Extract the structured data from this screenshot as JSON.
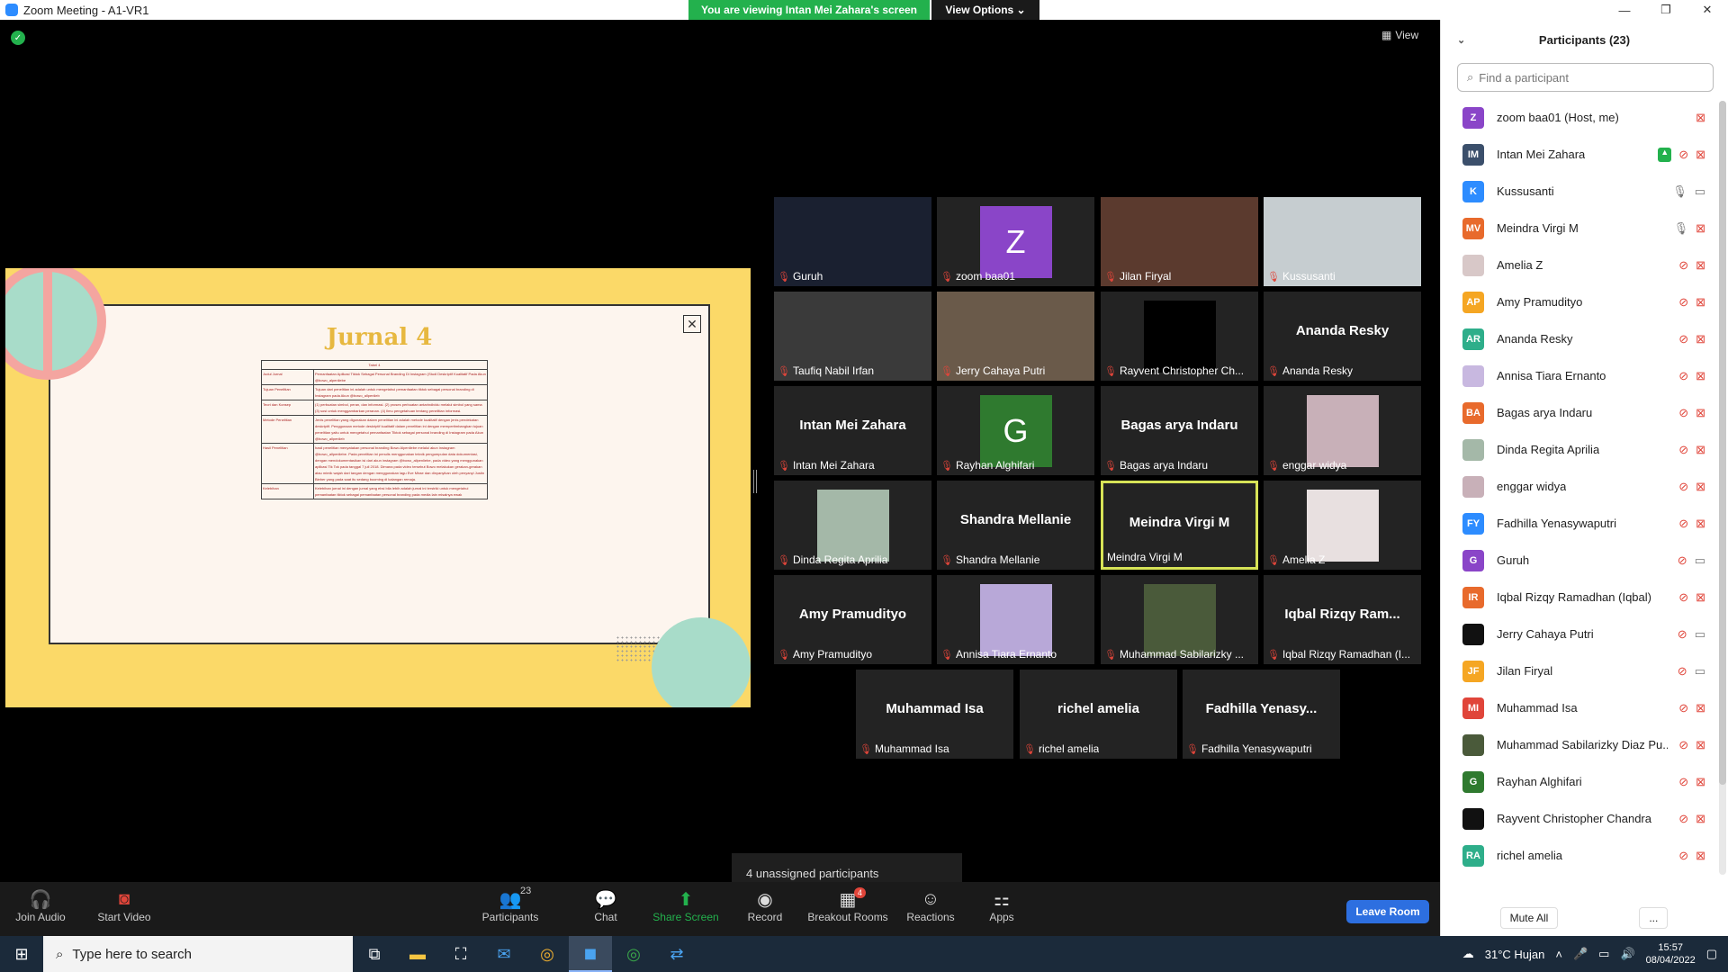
{
  "window": {
    "title": "Zoom Meeting - A1-VR1",
    "banner": "You are viewing Intan Mei Zahara's screen",
    "view_options": "View Options ⌄",
    "view_label": "View"
  },
  "slide": {
    "title": "Jurnal 4",
    "table_caption": "Tabel 4",
    "rows": [
      {
        "k": "Judul Jurnal",
        "v": "Pemanfaatan Aplikasi Tiktok Sebagai Personal Branding Di Instagram (Studi Deskriptif Kualitatif Pada Akun @bowo_alpenliebe"
      },
      {
        "k": "Tujuan Penelitian",
        "v": "Tujuan dari penelitian ini adalah untuk mengetahui pemanfaatan tiktok sebagai personal branding di Instagram pada Akun @bowo_allpenlieb"
      },
      {
        "k": "Teori dan Konsep",
        "v": "(1) perbuatan simbol, peran, dan informasi. (2) proses perbuatan antarindividu melalui simbol yang sama (3) sosi untuk menggambarkan peranan. (4) Ilmu pengetahuan tentang penelitian informasi."
      },
      {
        "k": "Metode Penelitian",
        "v": "Jenis penelitian yang digunakan dalam penelitian ini adalah metode kualitatif dengan jenis pendekatan deskriptif. Penggunaan metode deskriptif kualitatif dalam penelitian ini dengan mempertimbangkan tujuan penelitian yaitu untuk mengetahui pemanfaatan Tiktok sebagai personal branding di Instagram pada Akun @bowo_allpenlieb"
      },
      {
        "k": "Hasil Penelitian",
        "v": "hasil penelitian menyatakan personal branding Bowo Alpenliebe melalui akun instagram @bowo_allpenliebe. Pada penelitian ini penulis menggunakan teknik pengumpulan data dokumentasi, dengan mendokumentasikan isi dari akun instagram @bowo_allpenliebe, pada video yang menggunakan aplikasi Tik Tok pada tanggal 7 juli 2018. Dimana pada video tersebut Bowo melakukan gerakan-gerakan atau mimik wajah dari tangan dengan menggunakan lagu Eve Mirae dan dinyanyikan oleh penyanyi Justin Bieber yang pada saat itu sedang booming di kalangan remaja."
      },
      {
        "k": "Kelebihan",
        "v": "Kelebihan jurnal ini dengan jurnal yang ebsi bila lebih adalah jurnal ini terstriki untuk mengetahui pemanfaatan tiktok sebagai pemanfaatan personal branding pada media lain misalnya ewak"
      }
    ]
  },
  "gallery": [
    {
      "label": "Guruh",
      "big": "",
      "avatar": "photo",
      "color": "#1a2030"
    },
    {
      "label": "zoom baa01",
      "big": "",
      "avatar": "Z",
      "color": "#8a45c8"
    },
    {
      "label": "Jilan Firyal",
      "big": "",
      "avatar": "photo",
      "color": "#5b3a2e"
    },
    {
      "label": "Kussusanti",
      "big": "",
      "avatar": "photo",
      "color": "#c6cdd0"
    },
    {
      "label": "Taufiq Nabil Irfan",
      "big": "",
      "avatar": "photo",
      "color": "#3a3a3a"
    },
    {
      "label": "Jerry Cahaya Putri",
      "big": "",
      "avatar": "photo",
      "color": "#6a5a4a"
    },
    {
      "label": "Rayvent Christopher Ch...",
      "big": "",
      "avatar": "black",
      "color": "#000000"
    },
    {
      "label": "Ananda Resky",
      "big": "Ananda Resky",
      "avatar": "",
      "color": ""
    },
    {
      "label": "Intan Mei Zahara",
      "big": "Intan Mei Zahara",
      "avatar": "",
      "color": ""
    },
    {
      "label": "Rayhan Alghifari",
      "big": "",
      "avatar": "G",
      "color": "#2f7a2f"
    },
    {
      "label": "Bagas arya Indaru",
      "big": "Bagas arya Indaru",
      "avatar": "",
      "color": ""
    },
    {
      "label": "enggar widya",
      "big": "",
      "avatar": "photo",
      "color": "#c8b0b8"
    },
    {
      "label": "Dinda Regita Aprilia",
      "big": "",
      "avatar": "photo",
      "color": "#a4b8a8"
    },
    {
      "label": "Shandra Mellanie",
      "big": "Shandra Mellanie",
      "avatar": "",
      "color": ""
    },
    {
      "label": "Meindra Virgi M",
      "big": "Meindra Virgi M",
      "avatar": "",
      "color": ""
    },
    {
      "label": "Amelia Z",
      "big": "",
      "avatar": "photo",
      "color": "#e8e0e0"
    },
    {
      "label": "Amy Pramudityo",
      "big": "Amy Pramudityo",
      "avatar": "",
      "color": ""
    },
    {
      "label": "Annisa Tiara Ernanto",
      "big": "",
      "avatar": "photo",
      "color": "#b8a8d8"
    },
    {
      "label": "Muhammad Sabilarizky ...",
      "big": "",
      "avatar": "photo",
      "color": "#4a5a3a"
    },
    {
      "label": "Iqbal Rizqy Ramadhan (I...",
      "big": "Iqbal  Rizqy  Ram...",
      "avatar": "",
      "color": ""
    },
    {
      "label": "Muhammad Isa",
      "big": "Muhammad Isa",
      "avatar": "",
      "color": ""
    },
    {
      "label": "richel amelia",
      "big": "richel amelia",
      "avatar": "",
      "color": ""
    },
    {
      "label": "Fadhilla Yenasywaputri",
      "big": "Fadhilla  Yenasy...",
      "avatar": "",
      "color": ""
    }
  ],
  "unassigned": "4 unassigned participants",
  "toolbar": {
    "join_audio": "Join Audio",
    "start_video": "Start Video",
    "participants": "Participants",
    "participants_count": "23",
    "chat": "Chat",
    "share_screen": "Share Screen",
    "record": "Record",
    "breakout_rooms": "Breakout Rooms",
    "breakout_badge": "4",
    "reactions": "Reactions",
    "apps": "Apps",
    "leave": "Leave Room"
  },
  "panel": {
    "title": "Participants (23)",
    "search_placeholder": "Find a participant",
    "mute_all": "Mute All",
    "more": "...",
    "participants": [
      {
        "initials": "Z",
        "name": "zoom baa01 (Host, me)",
        "color": "#8a45c8",
        "mic": "none",
        "cam": "off",
        "share": false
      },
      {
        "initials": "IM",
        "name": "Intan Mei Zahara",
        "color": "#3b4f6b",
        "mic": "off",
        "cam": "off",
        "share": true
      },
      {
        "initials": "K",
        "name": "Kussusanti",
        "color": "#2d8cff",
        "mic": "on",
        "cam": "on",
        "share": false
      },
      {
        "initials": "MV",
        "name": "Meindra Virgi M",
        "color": "#e86a2c",
        "mic": "on",
        "cam": "off",
        "share": false
      },
      {
        "initials": "",
        "name": "Amelia Z",
        "color": "#d8c8c8",
        "mic": "off",
        "cam": "off",
        "share": false
      },
      {
        "initials": "AP",
        "name": "Amy Pramudityo",
        "color": "#f5a623",
        "mic": "off",
        "cam": "off",
        "share": false
      },
      {
        "initials": "AR",
        "name": "Ananda Resky",
        "color": "#2eae8a",
        "mic": "off",
        "cam": "off",
        "share": false
      },
      {
        "initials": "",
        "name": "Annisa Tiara Ernanto",
        "color": "#c8b8e0",
        "mic": "off",
        "cam": "off",
        "share": false
      },
      {
        "initials": "BA",
        "name": "Bagas arya Indaru",
        "color": "#e86a2c",
        "mic": "off",
        "cam": "off",
        "share": false
      },
      {
        "initials": "",
        "name": "Dinda Regita Aprilia",
        "color": "#a4b8a8",
        "mic": "off",
        "cam": "off",
        "share": false
      },
      {
        "initials": "",
        "name": "enggar widya",
        "color": "#c8b0b8",
        "mic": "off",
        "cam": "off",
        "share": false
      },
      {
        "initials": "FY",
        "name": "Fadhilla Yenasywaputri",
        "color": "#2d8cff",
        "mic": "off",
        "cam": "off",
        "share": false
      },
      {
        "initials": "G",
        "name": "Guruh",
        "color": "#8a45c8",
        "mic": "off",
        "cam": "on",
        "share": false
      },
      {
        "initials": "IR",
        "name": "Iqbal Rizqy Ramadhan (Iqbal)",
        "color": "#e86a2c",
        "mic": "off",
        "cam": "off",
        "share": false
      },
      {
        "initials": "",
        "name": "Jerry Cahaya Putri",
        "color": "#111111",
        "mic": "off",
        "cam": "on",
        "share": false
      },
      {
        "initials": "JF",
        "name": "Jilan Firyal",
        "color": "#f5a623",
        "mic": "off",
        "cam": "on",
        "share": false
      },
      {
        "initials": "MI",
        "name": "Muhammad Isa",
        "color": "#e0453a",
        "mic": "off",
        "cam": "off",
        "share": false
      },
      {
        "initials": "",
        "name": "Muhammad Sabilarizky Diaz Pu...",
        "color": "#4a5a3a",
        "mic": "off",
        "cam": "off",
        "share": false
      },
      {
        "initials": "G",
        "name": "Rayhan Alghifari",
        "color": "#2f7a2f",
        "mic": "off",
        "cam": "off",
        "share": false
      },
      {
        "initials": "",
        "name": "Rayvent Christopher Chandra",
        "color": "#111111",
        "mic": "off",
        "cam": "off",
        "share": false
      },
      {
        "initials": "RA",
        "name": "richel amelia",
        "color": "#2eae8a",
        "mic": "off",
        "cam": "off",
        "share": false
      }
    ]
  },
  "taskbar": {
    "search": "Type here to search",
    "weather": "31°C  Hujan",
    "time": "15:57",
    "date": "08/04/2022"
  }
}
